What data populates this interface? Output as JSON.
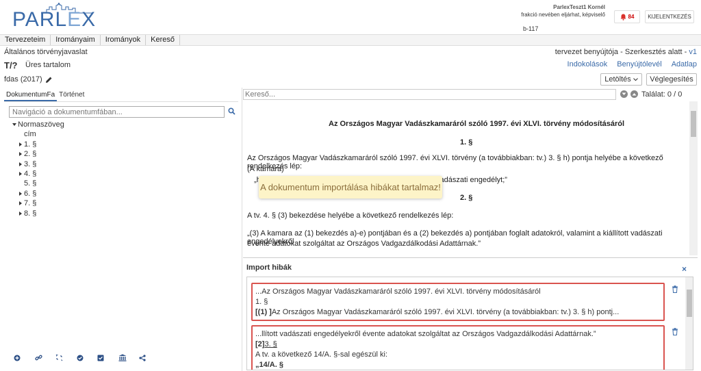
{
  "header": {
    "logo": "PARLEX",
    "user_name": "ParlexTeszt1 Kornél",
    "user_role": "frakció nevében eljárhat, képviselő",
    "user_code": "b-117",
    "notif_count": "84",
    "logout_label": "KIJELENTKEZÉS"
  },
  "menu": {
    "items": [
      "Tervezeteim",
      "Irományaim",
      "Irományok",
      "Kereső"
    ]
  },
  "document": {
    "type": "Általános törvényjavaslat",
    "status": "tervezet benyújtója - Szerkesztés alatt - ",
    "version": "v1",
    "code": "T/?",
    "title": "Üres tartalom",
    "name": "fdas (2017)",
    "links": [
      "Indokolások",
      "Benyújtólevél",
      "Adatlap"
    ],
    "download_label": "Letöltés",
    "finalize_label": "Véglegesítés"
  },
  "left_panel": {
    "tabs": [
      "DokumentumFa",
      "Történet"
    ],
    "nav_placeholder": "Navigáció a dokumentumfában...",
    "tree_root": "Normaszöveg",
    "tree_items": [
      {
        "label": "cím",
        "caret": false
      },
      {
        "label": "1. §",
        "caret": true
      },
      {
        "label": "2. §",
        "caret": true
      },
      {
        "label": "3. §",
        "caret": true
      },
      {
        "label": "4. §",
        "caret": true
      },
      {
        "label": "5. §",
        "caret": false
      },
      {
        "label": "6. §",
        "caret": true
      },
      {
        "label": "7. §",
        "caret": true
      },
      {
        "label": "8. §",
        "caret": true
      }
    ]
  },
  "search": {
    "placeholder": "Kereső...",
    "match_count": "Találat: 0 / 0"
  },
  "doc_text": {
    "heading": "Az Országos Magyar Vadászkamaráról szóló 1997. évi XLVI. törvény módosításáról",
    "sec1": "1. §",
    "p1": "Az Országos Magyar Vadászkamaráról szóló 1997. évi XLVI. törvény (a továbbiakban: tv.) 3. § h) pontja helyébe a következő rendelkezés lép:",
    "p1b": "(A kamara)",
    "p1c": "„h",
    "p1d": "vadászati engedélyt;”",
    "sec2": "2. §",
    "p2": "A tv. 4. § (3) bekezdése helyébe a következő rendelkezés lép:",
    "p3": "„(3) A kamara az (1) bekezdés a)-e) pontjában és a (2) bekezdés a) pontjában foglalt adatokról, valamint a kiállított vadászati engedélyekről",
    "p3b": "évente adatokat szolgáltat az Országos Vadgazdálkodási Adattárnak.”"
  },
  "toast": {
    "message": "A dokumentum importálása hibákat tartalmaz!"
  },
  "import_errors": {
    "title": "Import hibák",
    "close": "×",
    "items": [
      {
        "line1": "...Az Országos Magyar Vadászkamaráról szóló 1997. évi XLVI. törvény módosításáról",
        "line2": "1. §",
        "line3_bold": "[(1) ]",
        "line3": "Az Országos Magyar Vadászkamaráról szóló 1997. évi XLVI. törvény (a továbbiakban: tv.) 3. § h) pontj..."
      },
      {
        "line1": "...llított vadászati engedélyekről évente adatokat szolgáltat az Országos Vadgazdálkodási Adattárnak.”",
        "line2_bold": "[2]",
        "line2": "3. §",
        "line3": "A tv. a következő 14/A. §-sal egészül ki:",
        "line4": "„14/A. §"
      }
    ]
  },
  "colors": {
    "brand": "#3a6aa8",
    "error_border": "#d9534f",
    "toast_bg": "#fdf4c8"
  }
}
